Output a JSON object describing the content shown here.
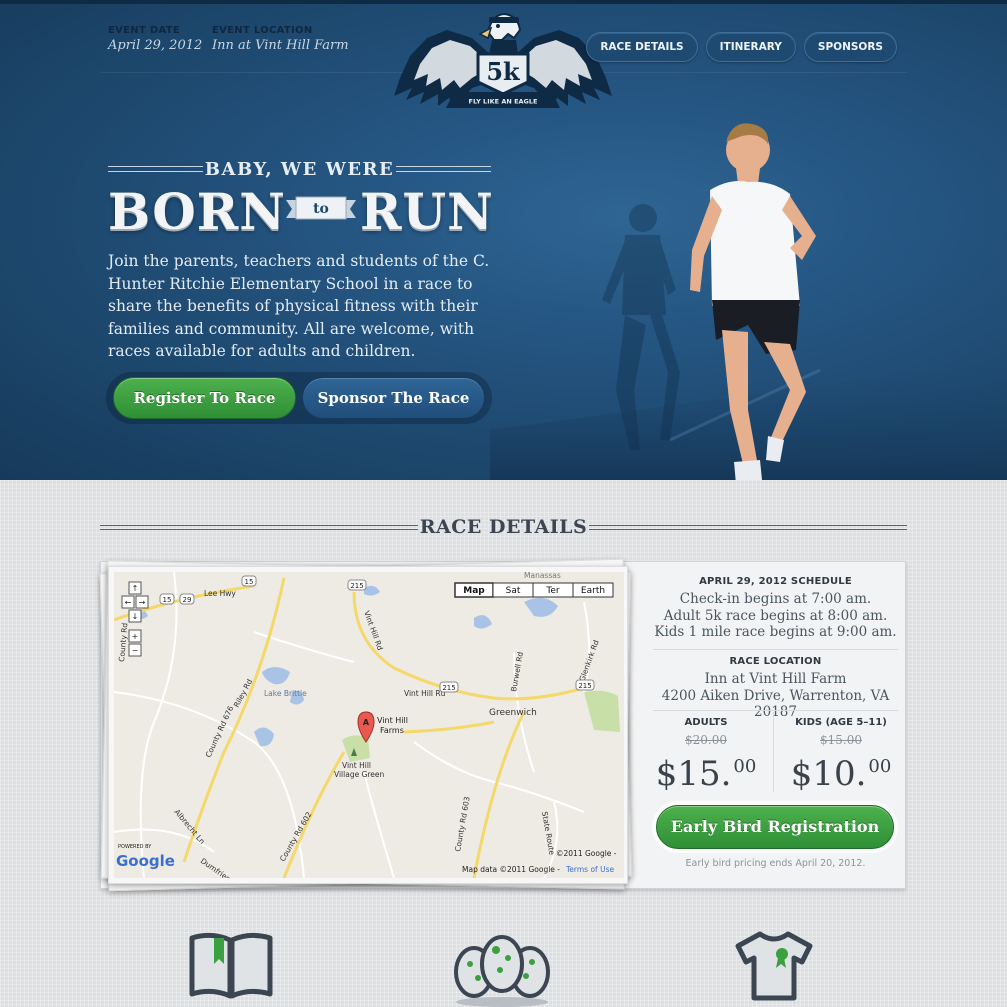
{
  "event": {
    "date_label": "EVENT DATE",
    "date_value": "April 29, 2012",
    "location_label": "EVENT LOCATION",
    "location_value": "Inn at Vint Hill Farm"
  },
  "logo": {
    "badge": "5k",
    "ribbon": "FLY LIKE AN EAGLE"
  },
  "nav": {
    "items": [
      "RACE DETAILS",
      "ITINERARY",
      "SPONSORS"
    ]
  },
  "hero": {
    "tagline_small": "BABY, WE WERE",
    "tagline_word1": "BORN",
    "tagline_connector": "to",
    "tagline_word2": "RUN",
    "intro": "Join the parents, teachers and students of the C. Hunter Ritchie Elementary School in a race to share the benefits of physical fitness with their families and community. All are welcome, with races available for adults and children.",
    "register_button": "Register To Race",
    "sponsor_button": "Sponsor The Race"
  },
  "details": {
    "section_title": "RACE DETAILS",
    "schedule_heading": "APRIL 29, 2012 SCHEDULE",
    "schedule": [
      "Check-in begins at 7:00 am.",
      "Adult 5k race begins at 8:00 am.",
      "Kids 1 mile race begins at 9:00 am."
    ],
    "location_heading": "RACE LOCATION",
    "location_name": "Inn at Vint Hill Farm",
    "location_address": "4200 Aiken Drive, Warrenton, VA 20187",
    "adults_heading": "ADULTS",
    "adults_old_price": "$20.00",
    "adults_price_dollars": "$15.",
    "adults_price_cents": "00",
    "kids_heading": "KIDS (AGE 5–11)",
    "kids_old_price": "$15.00",
    "kids_price_dollars": "$10.",
    "kids_price_cents": "00",
    "early_bird_button": "Early Bird Registration",
    "early_bird_note": "Early bird pricing ends April 20, 2012."
  },
  "map": {
    "type_buttons": [
      "Map",
      "Sat",
      "Ter",
      "Earth"
    ],
    "marker_letter": "A",
    "marker_label_1": "Vint Hill",
    "marker_label_2": "Farms",
    "labels": {
      "lee_hwy": "Lee Hwy",
      "vint_hill_rd": "Vint Hill Rd",
      "lake_brittle": "Lake Brittle",
      "greenwich": "Greenwich",
      "village_green_1": "Vint Hill",
      "village_green_2": "Village Green",
      "riley_rd": "Riley Rd",
      "county_rd_676": "County Rd 676",
      "county_rd_602": "County Rd 602",
      "county_rd_603": "County Rd 603",
      "burwell_rd": "Burwell Rd",
      "albrecht_ln": "Albrecht Ln",
      "dumfries": "Dumfries",
      "state_route": "State Route",
      "glenkirk_rd": "Glenkirk Rd",
      "manassas": "Manassas",
      "county_rd": "County Rd"
    },
    "shields": [
      "15",
      "15",
      "29",
      "215",
      "215",
      "215"
    ],
    "powered_by": "POWERED BY",
    "google": "Google",
    "copyright": "©2011 Google -",
    "map_data": "Map data ©2011 Google -",
    "terms": "Terms of Use"
  },
  "colors": {
    "hero_blue": "#245480",
    "green_button": "#3aa040",
    "accent_green": "#2f8f36"
  },
  "icons": [
    "book-icon",
    "eggs-icon",
    "tshirt-icon"
  ]
}
